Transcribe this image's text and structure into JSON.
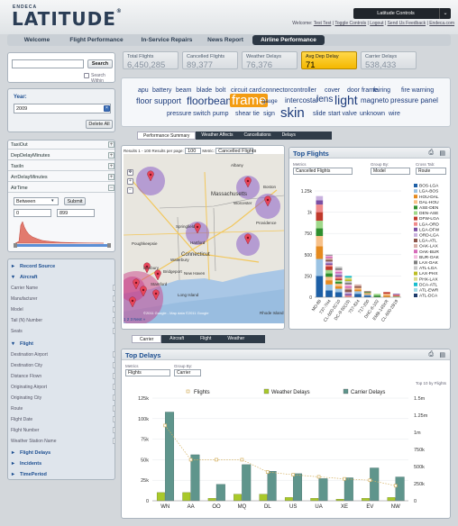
{
  "header": {
    "brand": "ENDECA",
    "logo": "LATITUDE",
    "logo_mark": "®",
    "controls_label": "Latitude Controls",
    "links": {
      "welcome": "Welcome:",
      "user": "Test Test",
      "toggle": "Toggle Controls",
      "logout": "Logout",
      "send": "Send Us Feedback",
      "site": "Endeca.com"
    }
  },
  "nav": {
    "tabs": [
      "Welcome",
      "Flight Performance",
      "In-Service Repairs",
      "News Report",
      "Airline Performance"
    ],
    "active": "Airline Performance"
  },
  "search": {
    "button": "Search",
    "within_label": "Search Within",
    "value": ""
  },
  "year": {
    "label": "Year:",
    "value": "2009",
    "delete_all": "Delete All",
    "clear": "×"
  },
  "metrics": {
    "items": [
      "TaxiOut",
      "DepDelayMinutes",
      "TaxiIn",
      "ArrDelayMinutes",
      "AirTime"
    ],
    "airtime": {
      "operator": "Between",
      "submit": "Submit",
      "min": "0",
      "max": "899"
    }
  },
  "facets": {
    "record_source": "Record Source",
    "aircraft": "Aircraft",
    "aircraft_items": [
      "Carrier Name",
      "Manufacturer",
      "Model",
      "Tail (N) Number",
      "Seats"
    ],
    "flight": "Flight",
    "flight_items": [
      "Destination Airport",
      "Destination City",
      "Distance Flown",
      "Originating Airport",
      "Originating City",
      "Route",
      "Flight Date",
      "Flight Number",
      "Weather Station Name"
    ],
    "flight_delays": "Flight Delays",
    "incidents": "Incidents",
    "time_period": "TimePeriod"
  },
  "kpis": [
    {
      "label": "Total Flights",
      "value": "6,450,285"
    },
    {
      "label": "Cancelled Flights",
      "value": "89,377"
    },
    {
      "label": "Weather Delays",
      "value": "76,376"
    },
    {
      "label": "Avg Dep Delay",
      "value": "71"
    },
    {
      "label": "Carrier Delays",
      "value": "538,433"
    }
  ],
  "tagcloud": [
    "apu",
    "battery",
    "beam",
    "blade",
    "bolt",
    "circuit card",
    "connector",
    "controller",
    "cover",
    "door frame",
    "fairing",
    "fire warning",
    "floor support",
    "floorbeam",
    "frame",
    "gauge",
    "intercostal",
    "lens",
    "light",
    "magneto",
    "pressure panel",
    "pressure switch",
    "pump",
    "shear tie",
    "sign",
    "skin",
    "slide",
    "start valve",
    "unknown",
    "wire"
  ],
  "top_tabs": [
    "Performance Summary",
    "Weather Affects",
    "Cancellations",
    "Delays"
  ],
  "map": {
    "results": "Results 1 - 100",
    "per_page_label": "Results per page:",
    "per_page": "100",
    "metric_label": "Metric:",
    "metric": "Cancelled Flights",
    "of": "of 256",
    "pager": "1 2 3 Next »",
    "credit": "©2011 Google - Map data ©2011 Google",
    "labels": [
      {
        "text": "Albany",
        "x": 255,
        "y": 180
      },
      {
        "text": "Massachusetts",
        "x": 233,
        "y": 212
      },
      {
        "text": "Boston",
        "x": 291,
        "y": 204
      },
      {
        "text": "Worcester",
        "x": 258,
        "y": 222
      },
      {
        "text": "Springfield",
        "x": 194,
        "y": 248
      },
      {
        "text": "Hartford",
        "x": 210,
        "y": 266
      },
      {
        "text": "Providence",
        "x": 283,
        "y": 244
      },
      {
        "text": "Connecticut",
        "x": 200,
        "y": 279
      },
      {
        "text": "Poughkeepsie",
        "x": 145,
        "y": 267
      },
      {
        "text": "Waterbury",
        "x": 188,
        "y": 285
      },
      {
        "text": "New Haven",
        "x": 203,
        "y": 300
      },
      {
        "text": "Bridgeport",
        "x": 180,
        "y": 298
      },
      {
        "text": "Stamford",
        "x": 166,
        "y": 312
      },
      {
        "text": "Danbury",
        "x": 158,
        "y": 294
      },
      {
        "text": "Long Island",
        "x": 196,
        "y": 324
      },
      {
        "text": "Rhode Island",
        "x": 287,
        "y": 344
      }
    ]
  },
  "top_flights": {
    "title": "Top Flights",
    "metrics_label": "Metrics",
    "metric": "Cancelled Flights",
    "group_label": "Group By:",
    "group": "Model",
    "cross_label": "Cross Tab:",
    "cross": "Route"
  },
  "bottom_tabs": [
    "Carrier",
    "Aircraft",
    "Flight",
    "Weather"
  ],
  "top_delays": {
    "title": "Top Delays",
    "metrics_label": "Metrics",
    "metric": "Flights",
    "group_label": "Group By:",
    "group": "Carrier",
    "top_label": "Top 10 by Flights"
  },
  "colors": {
    "nav": "#2c3744",
    "kpi_highlight": "#f4b800",
    "link": "#1d4f91",
    "flights_line": "#d4b060",
    "weather": "#a9c92a",
    "carrier": "#5f958c"
  },
  "chart_data": [
    {
      "type": "bar",
      "title": "Top Flights",
      "categories": [
        "MD-88",
        "737-7H4",
        "CL-600-2C10",
        "DC-9-50(15)",
        "737-824",
        "717-200",
        "DHC-8-102",
        "EMB-145XR",
        "CL-600-2B19"
      ],
      "series": [
        {
          "name": "BOS-LGA",
          "values": [
            250,
            80,
            60,
            0,
            40,
            20,
            0,
            0,
            0
          ]
        },
        {
          "name": "LGA-BOS",
          "values": [
            200,
            70,
            40,
            0,
            30,
            10,
            0,
            0,
            0
          ]
        },
        {
          "name": "HOU-DAL",
          "values": [
            150,
            50,
            30,
            0,
            20,
            10,
            0,
            20,
            0
          ]
        },
        {
          "name": "DAL-HOU",
          "values": [
            120,
            40,
            30,
            0,
            20,
            10,
            0,
            20,
            0
          ]
        },
        {
          "name": "ASE-DEN",
          "values": [
            90,
            40,
            20,
            0,
            0,
            10,
            20,
            0,
            0
          ]
        },
        {
          "name": "DEN-ASE",
          "values": [
            90,
            40,
            20,
            0,
            0,
            0,
            20,
            0,
            10
          ]
        },
        {
          "name": "DFW-LGA",
          "values": [
            100,
            40,
            20,
            0,
            0,
            0,
            0,
            20,
            10
          ]
        },
        {
          "name": "LGA-ORD",
          "values": [
            90,
            20,
            20,
            20,
            0,
            0,
            0,
            0,
            10
          ]
        },
        {
          "name": "LGA-DFW",
          "values": [
            50,
            20,
            20,
            20,
            0,
            0,
            0,
            0,
            10
          ]
        },
        {
          "name": "ORD-LGA",
          "values": [
            50,
            20,
            20,
            20,
            0,
            0,
            0,
            0,
            0
          ]
        },
        {
          "name": "LGA-ATL",
          "values": [
            0,
            20,
            0,
            30,
            20,
            10,
            0,
            0,
            0
          ]
        },
        {
          "name": "OAK-LAX",
          "values": [
            0,
            20,
            0,
            20,
            20,
            0,
            0,
            0,
            0
          ]
        },
        {
          "name": "OAK-BUR",
          "values": [
            0,
            20,
            20,
            20,
            0,
            0,
            0,
            0,
            0
          ]
        },
        {
          "name": "BUR-OAK",
          "values": [
            0,
            10,
            20,
            20,
            0,
            0,
            0,
            0,
            0
          ]
        },
        {
          "name": "LAX-OAK",
          "values": [
            0,
            10,
            20,
            20,
            0,
            0,
            0,
            0,
            0
          ]
        },
        {
          "name": "ATL-LGA",
          "values": [
            0,
            0,
            20,
            20,
            0,
            0,
            0,
            0,
            0
          ]
        },
        {
          "name": "LAX-PHX",
          "values": [
            0,
            0,
            0,
            20,
            0,
            0,
            0,
            0,
            0
          ]
        },
        {
          "name": "PHX-LAX",
          "values": [
            0,
            0,
            0,
            20,
            0,
            0,
            0,
            0,
            0
          ]
        },
        {
          "name": "DCA-ATL",
          "values": [
            0,
            0,
            0,
            20,
            0,
            0,
            0,
            0,
            0
          ]
        },
        {
          "name": "ATL-EWR",
          "values": [
            0,
            0,
            0,
            0,
            0,
            0,
            0,
            0,
            0
          ]
        },
        {
          "name": "ATL-DCA",
          "values": [
            0,
            0,
            0,
            0,
            0,
            0,
            0,
            0,
            0
          ]
        }
      ],
      "colors": [
        "#1d5fa6",
        "#9bc3e3",
        "#e58a1f",
        "#f7c18a",
        "#2f8f2f",
        "#9fd88a",
        "#c0392b",
        "#f08a8a",
        "#7b4fa3",
        "#c9b2df",
        "#8c564b",
        "#d7b0a8",
        "#d66ab8",
        "#f3bcdf",
        "#7f7f7f",
        "#c7c7c7",
        "#bcbd22",
        "#dbdb8d",
        "#17becf",
        "#9edae5",
        "#1d3a6b"
      ],
      "ylim": [
        0,
        1250
      ],
      "yticks": [
        "1.25k",
        "1k",
        "750",
        "500",
        "250",
        "0"
      ],
      "ytick_values": [
        1250,
        1000,
        750,
        500,
        250,
        0
      ]
    },
    {
      "type": "bar",
      "title": "Top Delays",
      "categories": [
        "WN",
        "AA",
        "OO",
        "MQ",
        "DL",
        "US",
        "UA",
        "XE",
        "EV",
        "NW"
      ],
      "series": [
        {
          "name": "Flights",
          "type": "line",
          "axis": "right",
          "values": [
            1.1,
            0.6,
            0.6,
            0.6,
            0.42,
            0.38,
            0.35,
            0.32,
            0.3,
            0.22
          ]
        },
        {
          "name": "Weather Delays",
          "values": [
            10,
            10,
            3,
            8,
            8,
            4,
            3,
            2,
            3,
            4
          ]
        },
        {
          "name": "Carrier Delays",
          "values": [
            108,
            56,
            20,
            44,
            36,
            33,
            27,
            28,
            40,
            29
          ]
        }
      ],
      "left_ticks": [
        "125k",
        "100k",
        "75k",
        "50k",
        "25k",
        "0"
      ],
      "left_tick_values": [
        125,
        100,
        75,
        50,
        25,
        0
      ],
      "right_ticks": [
        "1.5m",
        "1.25m",
        "1m",
        "750k",
        "500k",
        "250k",
        "0"
      ],
      "right_tick_values": [
        1.5,
        1.25,
        1,
        0.75,
        0.5,
        0.25,
        0
      ],
      "ylim_left": [
        0,
        125
      ],
      "ylim_right": [
        0,
        1.5
      ]
    }
  ]
}
